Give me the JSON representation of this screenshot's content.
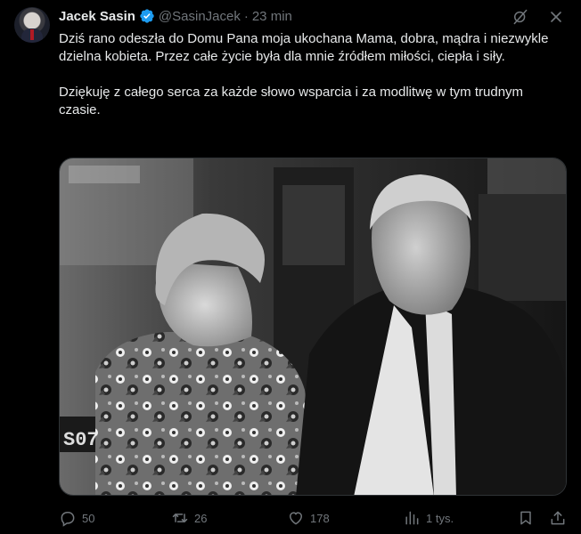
{
  "author": {
    "name": "Jacek Sasin",
    "handle": "@SasinJacek",
    "separator": "·",
    "time": "23 min",
    "verified": true
  },
  "tweet": {
    "paragraph1": "Dziś rano odeszła do Domu Pana moja ukochana Mama, dobra, mądra i niezwykle dzielna kobieta. Przez całe życie była dla mnie źródłem miłości, ciepła i siły.",
    "paragraph2": "Dziękuję z całego serca za każde słowo wsparcia i za modlitwę w tym trudnym czasie."
  },
  "actions": {
    "replies": "50",
    "reposts": "26",
    "likes": "178",
    "views": "1 tys."
  },
  "colors": {
    "background": "#000000",
    "text": "#e7e9ea",
    "muted": "#71767b",
    "verified": "#1d9bf0",
    "border": "#2f3336"
  },
  "icons": {
    "top": [
      "grok-icon",
      "more-icon"
    ],
    "actions": [
      "reply-icon",
      "repost-icon",
      "like-icon",
      "views-icon",
      "bookmark-icon",
      "share-icon"
    ]
  }
}
